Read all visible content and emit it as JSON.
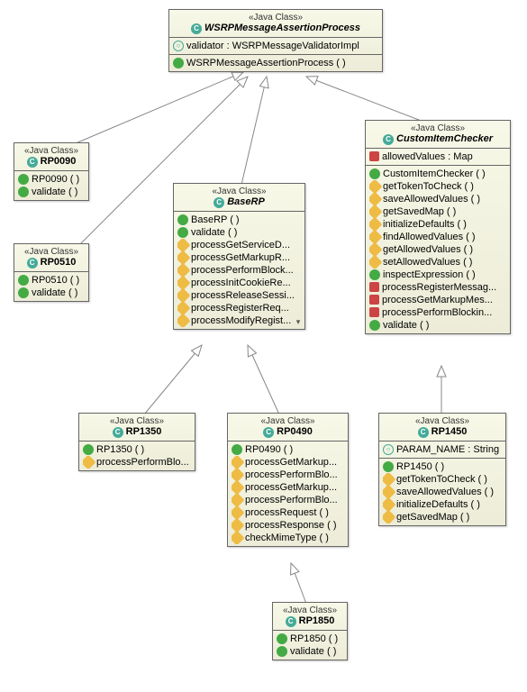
{
  "stereotype": "«Java Class»",
  "classes": {
    "wsrp": {
      "name": "WSRPMessageAssertionProcess",
      "attrs": [
        {
          "icon": "open",
          "text": "validator : WSRPMessageValidatorImpl"
        }
      ],
      "methods": [
        {
          "icon": "pub",
          "text": "WSRPMessageAssertionProcess ( )"
        }
      ]
    },
    "rp0090": {
      "name": "RP0090",
      "methods": [
        {
          "icon": "pub",
          "text": "RP0090 ( )"
        },
        {
          "icon": "pub",
          "text": "validate ( )"
        }
      ]
    },
    "rp0510": {
      "name": "RP0510",
      "methods": [
        {
          "icon": "pub",
          "text": "RP0510 ( )"
        },
        {
          "icon": "pub",
          "text": "validate ( )"
        }
      ]
    },
    "baserp": {
      "name": "BaseRP",
      "methods": [
        {
          "icon": "pub",
          "text": "BaseRP ( )"
        },
        {
          "icon": "pub",
          "text": "validate ( )"
        },
        {
          "icon": "prot",
          "text": "processGetServiceD..."
        },
        {
          "icon": "prot",
          "text": "processGetMarkupR..."
        },
        {
          "icon": "prot",
          "text": "processPerformBlock..."
        },
        {
          "icon": "prot",
          "text": "processInitCookieRe..."
        },
        {
          "icon": "prot",
          "text": "processReleaseSessi..."
        },
        {
          "icon": "prot",
          "text": "processRegisterReq..."
        },
        {
          "icon": "prot",
          "text": "processModifyRegist..."
        }
      ]
    },
    "custom": {
      "name": "CustomItemChecker",
      "attrs": [
        {
          "icon": "priv",
          "text": "allowedValues : Map"
        }
      ],
      "methods": [
        {
          "icon": "pub",
          "text": "CustomItemChecker ( )"
        },
        {
          "icon": "prot",
          "text": "getTokenToCheck ( )"
        },
        {
          "icon": "prot",
          "text": "saveAllowedValues ( )"
        },
        {
          "icon": "prot",
          "text": "getSavedMap ( )"
        },
        {
          "icon": "prot",
          "text": "initializeDefaults ( )"
        },
        {
          "icon": "prot",
          "text": "findAllowedValues ( )"
        },
        {
          "icon": "prot",
          "text": "getAllowedValues ( )"
        },
        {
          "icon": "prot",
          "text": "setAllowedValues ( )"
        },
        {
          "icon": "pub",
          "text": "inspectExpression ( )"
        },
        {
          "icon": "priv",
          "text": "processRegisterMessag..."
        },
        {
          "icon": "priv",
          "text": "processGetMarkupMes..."
        },
        {
          "icon": "priv",
          "text": "processPerformBlockin..."
        },
        {
          "icon": "pub",
          "text": "validate ( )"
        }
      ]
    },
    "rp1350": {
      "name": "RP1350",
      "methods": [
        {
          "icon": "pub",
          "text": "RP1350 ( )"
        },
        {
          "icon": "prot",
          "text": "processPerformBlo..."
        }
      ]
    },
    "rp0490": {
      "name": "RP0490",
      "methods": [
        {
          "icon": "pub",
          "text": "RP0490 ( )"
        },
        {
          "icon": "prot",
          "text": "processGetMarkup..."
        },
        {
          "icon": "prot",
          "text": "processPerformBlo..."
        },
        {
          "icon": "prot",
          "text": "processGetMarkup..."
        },
        {
          "icon": "prot",
          "text": "processPerformBlo..."
        },
        {
          "icon": "prot",
          "text": "processRequest ( )"
        },
        {
          "icon": "prot",
          "text": "processResponse ( )"
        },
        {
          "icon": "prot",
          "text": "checkMimeType ( )"
        }
      ]
    },
    "rp1450": {
      "name": "RP1450",
      "attrs": [
        {
          "icon": "open",
          "text": "PARAM_NAME : String"
        }
      ],
      "methods": [
        {
          "icon": "pub",
          "text": "RP1450 ( )"
        },
        {
          "icon": "prot",
          "text": "getTokenToCheck ( )"
        },
        {
          "icon": "prot",
          "text": "saveAllowedValues ( )"
        },
        {
          "icon": "prot",
          "text": "initializeDefaults ( )"
        },
        {
          "icon": "prot",
          "text": "getSavedMap ( )"
        }
      ]
    },
    "rp1850": {
      "name": "RP1850",
      "methods": [
        {
          "icon": "pub",
          "text": "RP1850 ( )"
        },
        {
          "icon": "pub",
          "text": "validate ( )"
        }
      ]
    }
  }
}
